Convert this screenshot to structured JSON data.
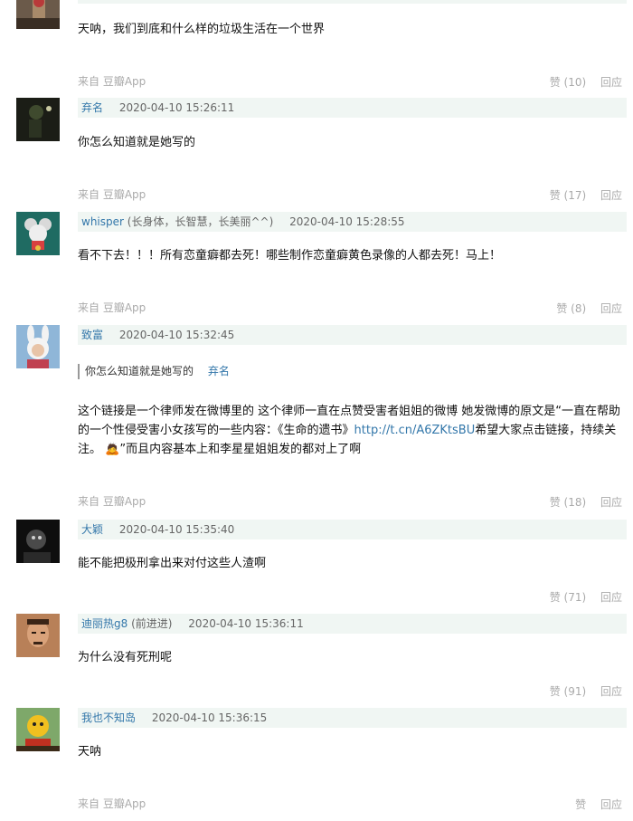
{
  "comment0": {
    "text": "天呐，我们到底和什么样的垃圾生活在一个世界",
    "source": "来自 豆瓣App",
    "like": "赞 (10)",
    "reply": "回应"
  },
  "comment1": {
    "user": "弃名",
    "time": "2020-04-10 15:26:11",
    "text": "你怎么知道就是她写的",
    "source": "来自 豆瓣App",
    "like": "赞 (17)",
    "reply": "回应"
  },
  "comment2": {
    "user": "whisper",
    "label": "(长身体，长智慧，长美丽^^)",
    "time": "2020-04-10 15:28:55",
    "text": "看不下去！！！所有恋童癖都去死！哪些制作恋童癖黄色录像的人都去死！马上！",
    "source": "来自 豆瓣App",
    "like": "赞 (8)",
    "reply": "回应"
  },
  "comment3": {
    "user": "致富",
    "time": "2020-04-10 15:32:45",
    "quote_text": "你怎么知道就是她写的",
    "quote_author": "弃名",
    "text_part1": "这个链接是一个律师发在微博里的 这个律师一直在点赞受害者姐姐的微博 她发微博的原文是“一直在帮助的一个性侵受害小女孩写的一些内容：《生命的遗书》",
    "link": "http://t.cn/A6ZKtsBU",
    "text_part2": "希望大家点击链接，持续关注。",
    "emoji": "🙇",
    "text_part3": "”而且内容基本上和李星星姐姐发的都对上了啊",
    "source": "来自 豆瓣App",
    "like": "赞 (18)",
    "reply": "回应"
  },
  "comment4": {
    "user": "大颖",
    "time": "2020-04-10 15:35:40",
    "text": "能不能把极刑拿出来对付这些人渣啊",
    "like": "赞 (71)",
    "reply": "回应"
  },
  "comment5": {
    "user": "迪丽热g8",
    "label": "(前进进)",
    "time": "2020-04-10 15:36:11",
    "text": "为什么没有死刑呢",
    "like": "赞 (91)",
    "reply": "回应"
  },
  "comment6": {
    "user": "我也不知岛",
    "time": "2020-04-10 15:36:15",
    "text": "天呐",
    "source": "来自 豆瓣App",
    "like": "赞",
    "reply": "回应"
  }
}
